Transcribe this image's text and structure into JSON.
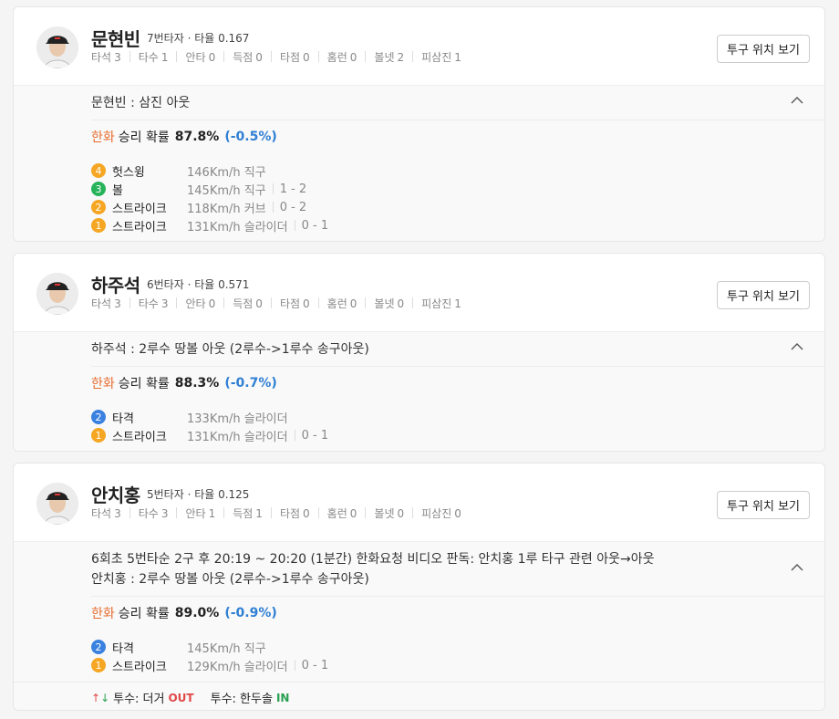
{
  "players": [
    {
      "name": "문현빈",
      "order": "7번타자 · 타율 0.167",
      "stats": [
        {
          "label": "타석",
          "value": "3"
        },
        {
          "label": "타수",
          "value": "1"
        },
        {
          "label": "안타",
          "value": "0"
        },
        {
          "label": "득점",
          "value": "0"
        },
        {
          "label": "타점",
          "value": "0"
        },
        {
          "label": "홈런",
          "value": "0"
        },
        {
          "label": "볼넷",
          "value": "2"
        },
        {
          "label": "피삼진",
          "value": "1"
        }
      ],
      "button": "투구 위치 보기",
      "result_lines": [
        "문현빈 : 삼진 아웃"
      ],
      "win": {
        "team": "한화",
        "label": "승리 확률",
        "prob": "87.8%",
        "delta": "(-0.5%)"
      },
      "pitches": [
        {
          "num": "4",
          "color": "orange",
          "type": "헛스윙",
          "detail": "146Km/h 직구",
          "count": ""
        },
        {
          "num": "3",
          "color": "green",
          "type": "볼",
          "detail": "145Km/h 직구",
          "count": "1 - 2"
        },
        {
          "num": "2",
          "color": "orange",
          "type": "스트라이크",
          "detail": "118Km/h 커브",
          "count": "0 - 2"
        },
        {
          "num": "1",
          "color": "orange",
          "type": "스트라이크",
          "detail": "131Km/h 슬라이더",
          "count": "0 - 1"
        }
      ]
    },
    {
      "name": "하주석",
      "order": "6번타자 · 타율 0.571",
      "stats": [
        {
          "label": "타석",
          "value": "3"
        },
        {
          "label": "타수",
          "value": "3"
        },
        {
          "label": "안타",
          "value": "0"
        },
        {
          "label": "득점",
          "value": "0"
        },
        {
          "label": "타점",
          "value": "0"
        },
        {
          "label": "홈런",
          "value": "0"
        },
        {
          "label": "볼넷",
          "value": "0"
        },
        {
          "label": "피삼진",
          "value": "1"
        }
      ],
      "button": "투구 위치 보기",
      "result_lines": [
        "하주석 : 2루수 땅볼 아웃 (2루수->1루수 송구아웃)"
      ],
      "win": {
        "team": "한화",
        "label": "승리 확률",
        "prob": "88.3%",
        "delta": "(-0.7%)"
      },
      "pitches": [
        {
          "num": "2",
          "color": "blue",
          "type": "타격",
          "detail": "133Km/h 슬라이더",
          "count": ""
        },
        {
          "num": "1",
          "color": "orange",
          "type": "스트라이크",
          "detail": "131Km/h 슬라이더",
          "count": "0 - 1"
        }
      ]
    },
    {
      "name": "안치홍",
      "order": "5번타자 · 타율 0.125",
      "stats": [
        {
          "label": "타석",
          "value": "3"
        },
        {
          "label": "타수",
          "value": "3"
        },
        {
          "label": "안타",
          "value": "1"
        },
        {
          "label": "득점",
          "value": "1"
        },
        {
          "label": "타점",
          "value": "0"
        },
        {
          "label": "홈런",
          "value": "0"
        },
        {
          "label": "볼넷",
          "value": "0"
        },
        {
          "label": "피삼진",
          "value": "0"
        }
      ],
      "button": "투구 위치 보기",
      "result_lines": [
        "6회초 5번타순 2구 후 20:19 ~ 20:20 (1분간) 한화요청 비디오 판독: 안치홍 1루 타구 관련 아웃→아웃",
        "안치홍 : 2루수 땅볼 아웃 (2루수->1루수 송구아웃)"
      ],
      "win": {
        "team": "한화",
        "label": "승리 확률",
        "prob": "89.0%",
        "delta": "(-0.9%)"
      },
      "pitches": [
        {
          "num": "2",
          "color": "blue",
          "type": "타격",
          "detail": "145Km/h 직구",
          "count": ""
        },
        {
          "num": "1",
          "color": "orange",
          "type": "스트라이크",
          "detail": "129Km/h 슬라이더",
          "count": "0 - 1"
        }
      ],
      "change": {
        "out_label": "투수: 더거",
        "out_tag": "OUT",
        "in_label": "투수: 한두솔",
        "in_tag": "IN"
      }
    }
  ]
}
